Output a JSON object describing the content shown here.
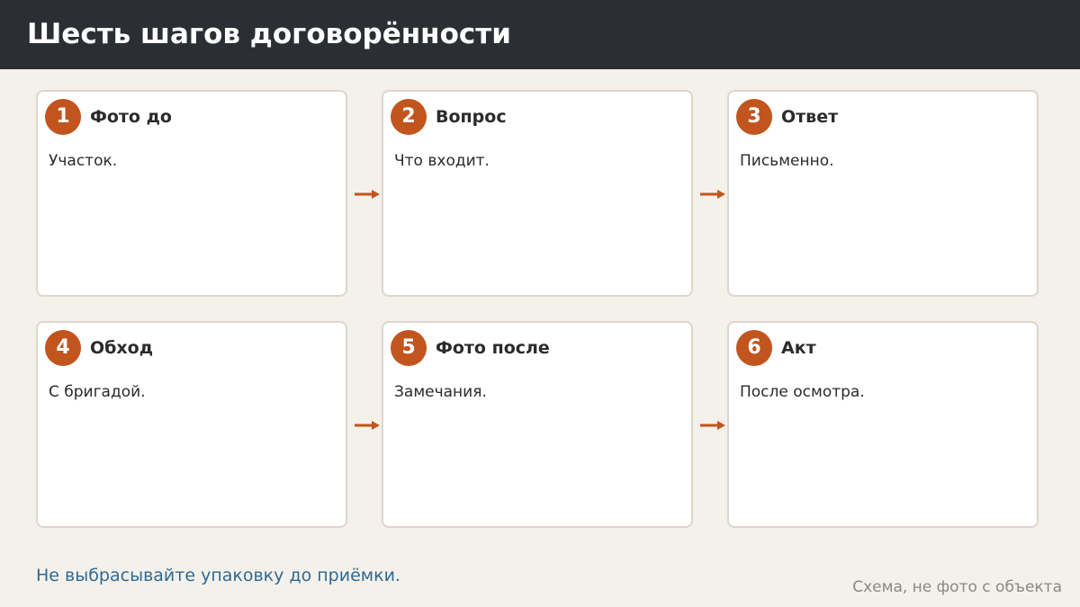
{
  "title": "Шесть шагов договорённости",
  "steps": [
    {
      "number": "1",
      "title": "Фото до",
      "text": "Участок."
    },
    {
      "number": "2",
      "title": "Вопрос",
      "text": "Что входит."
    },
    {
      "number": "3",
      "title": "Ответ",
      "text": "Письменно."
    },
    {
      "number": "4",
      "title": "Обход",
      "text": "С бригадой."
    },
    {
      "number": "5",
      "title": "Фото после",
      "text": "Замечания."
    },
    {
      "number": "6",
      "title": "Акт",
      "text": "После осмотра."
    }
  ],
  "footer_note": "Не выбрасывайте упаковку до приёмки.",
  "caption": "Схема, не фото с объекта",
  "colors": {
    "header_bg": "#2b2e33",
    "accent": "#c2541e",
    "note": "#2f6a92",
    "page_bg": "#f4f1eb"
  }
}
